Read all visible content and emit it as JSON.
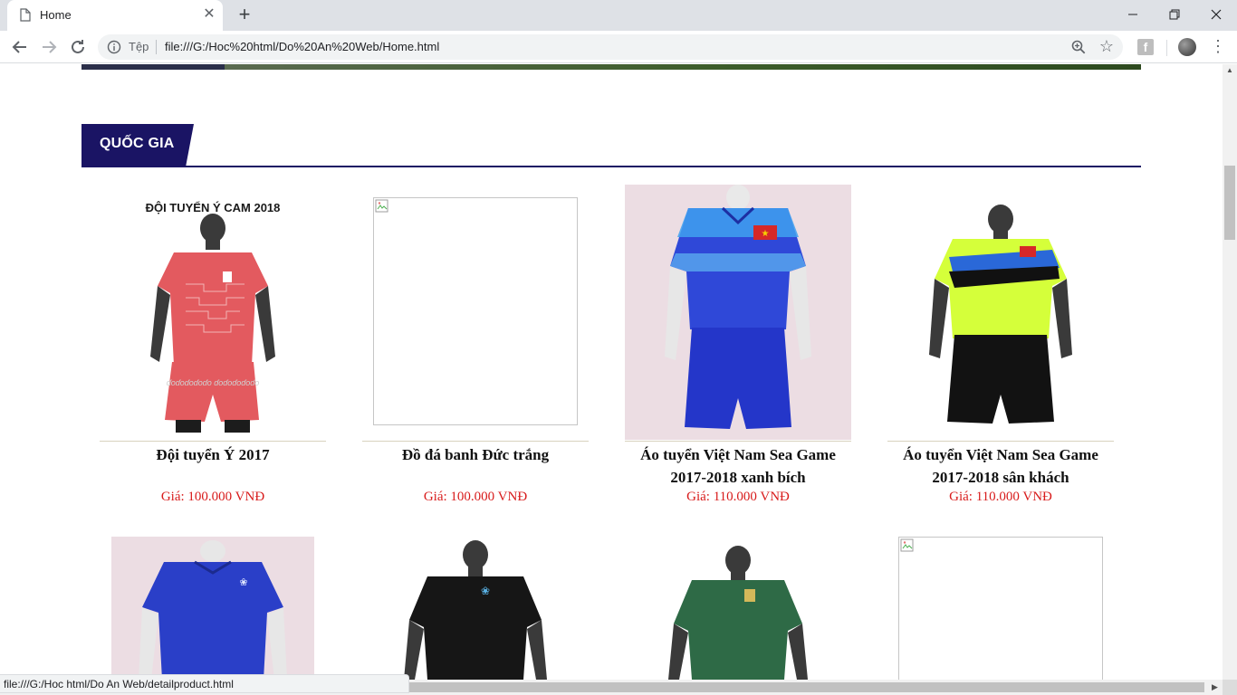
{
  "browser": {
    "tab_title": "Home",
    "tab_close_glyph": "✕",
    "new_tab_glyph": "+",
    "scheme_label": "Tệp",
    "url": "file:///G:/Hoc%20html/Do%20An%20Web/Home.html",
    "status_url": "file:///G:/Hoc html/Do An Web/detailproduct.html",
    "menu_glyph": "⋮",
    "star_glyph": "☆",
    "fb_glyph": "f",
    "window_controls": {
      "minimize": "—",
      "restore": "❐",
      "close": "✕"
    }
  },
  "section": {
    "title": "QUỐC GIA",
    "accent_color": "#1a1464"
  },
  "products": [
    {
      "name": "Đội tuyển Ý 2017",
      "price": "Giá: 100.000 VNĐ",
      "image_label": "ĐỘI TUYỂN Ý CAM 2018",
      "image": "pink-kit"
    },
    {
      "name": "Đồ đá banh Đức trắng",
      "price": "Giá: 100.000 VNĐ",
      "image": "broken"
    },
    {
      "name": "Áo tuyển Việt Nam Sea Game 2017-2018 xanh bích",
      "price": "Giá: 110.000 VNĐ",
      "image": "blue-kit"
    },
    {
      "name": "Áo tuyển Việt Nam Sea Game 2017-2018 sân khách",
      "price": "Giá: 110.000 VNĐ",
      "image": "lime-kit"
    }
  ],
  "products_row2": [
    {
      "image": "france-blue-kit"
    },
    {
      "image": "black-kit"
    },
    {
      "image": "green-kit"
    },
    {
      "image": "broken"
    }
  ],
  "colors": {
    "price": "#d81b1b",
    "section_blue": "#1a1464"
  }
}
